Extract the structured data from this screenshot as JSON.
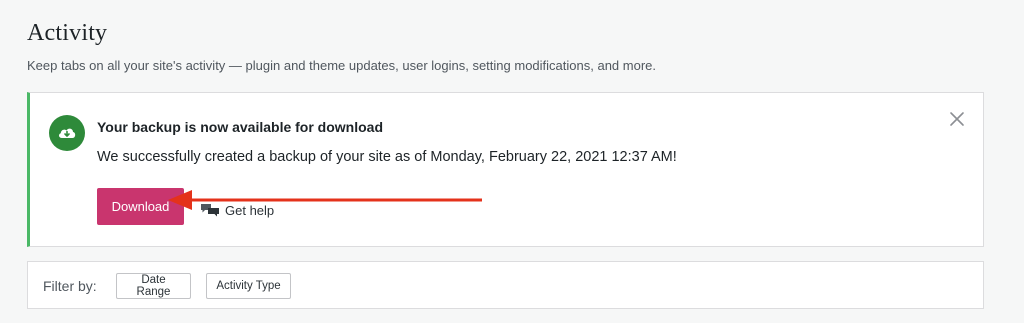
{
  "header": {
    "title": "Activity",
    "subtitle": "Keep tabs on all your site's activity — plugin and theme updates, user logins, setting modifications, and more."
  },
  "notice": {
    "icon": "cloud-download-icon",
    "title": "Your backup is now available for download",
    "message": "We successfully created a backup of your site as of Monday, February 22, 2021 12:37 AM!",
    "download_label": "Download",
    "help_label": "Get help",
    "accent_color": "#4ab866",
    "button_color": "#c9356e"
  },
  "annotation": {
    "arrow_color": "#e4321b"
  },
  "filter": {
    "label": "Filter by:",
    "buttons": [
      "Date Range",
      "Activity Type"
    ]
  }
}
